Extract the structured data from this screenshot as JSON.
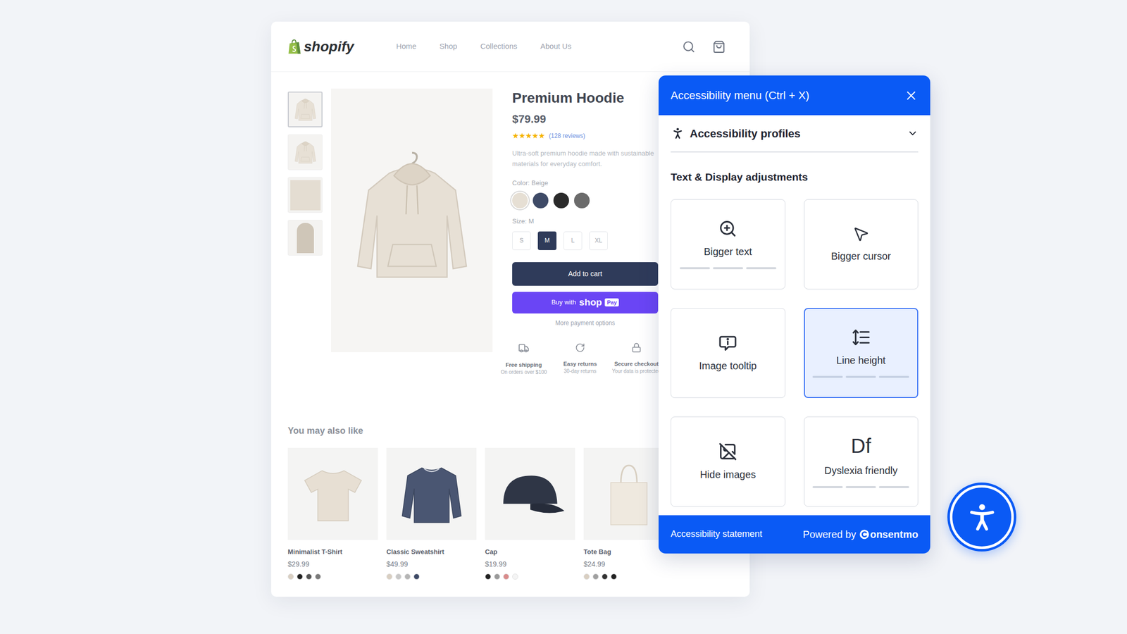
{
  "store": {
    "logo": "shopify",
    "nav": [
      "Home",
      "Shop",
      "Collections",
      "About Us"
    ],
    "thumbnails": [
      {
        "selected": true
      },
      {
        "selected": false
      },
      {
        "selected": false
      },
      {
        "selected": false
      }
    ],
    "product": {
      "title": "Premium Hoodie",
      "price": "$79.99",
      "stars": 5,
      "reviews": "(128 reviews)",
      "description": "Ultra-soft premium hoodie made with sustainable materials for everyday comfort.",
      "color_label": "Color: Beige",
      "colors": [
        {
          "color": "#e6dfd4",
          "selected": true
        },
        {
          "color": "#3e4a66",
          "selected": false
        },
        {
          "color": "#2a2a2a",
          "selected": false
        },
        {
          "color": "#6b6b6b",
          "selected": false
        }
      ],
      "size_label": "Size: M",
      "sizes": [
        {
          "label": "S",
          "selected": false
        },
        {
          "label": "M",
          "selected": true
        },
        {
          "label": "L",
          "selected": false
        },
        {
          "label": "XL",
          "selected": false
        }
      ],
      "add_to_cart": "Add to cart",
      "buy_prefix": "Buy with",
      "buy_brand": "shop",
      "buy_badge": "Pay",
      "more_options": "More payment options",
      "features": [
        {
          "title": "Free shipping",
          "subtitle": "On orders over $100"
        },
        {
          "title": "Easy returns",
          "subtitle": "30-day returns"
        },
        {
          "title": "Secure checkout",
          "subtitle": "Your data is protected"
        }
      ]
    },
    "related": {
      "title": "You may also like",
      "items": [
        {
          "name": "Minimalist T-Shirt",
          "price": "$29.99",
          "colors": [
            {
              "color": "#d9cfc2"
            },
            {
              "color": "#222222"
            },
            {
              "color": "#555555"
            },
            {
              "color": "#7a7a7a"
            }
          ]
        },
        {
          "name": "Classic Sweatshirt",
          "price": "$49.99",
          "colors": [
            {
              "color": "#d9cfc2"
            },
            {
              "color": "#c8c8c8"
            },
            {
              "color": "#b5b5b5"
            },
            {
              "color": "#3e4a66"
            }
          ]
        },
        {
          "name": "Cap",
          "price": "$19.99",
          "colors": [
            {
              "color": "#222222"
            },
            {
              "color": "#9a9a9a"
            },
            {
              "color": "#d98b8b"
            },
            {
              "color": "#f4f4f4"
            }
          ]
        },
        {
          "name": "Tote Bag",
          "price": "$24.99",
          "colors": [
            {
              "color": "#d9cfc2"
            },
            {
              "color": "#a0a0a0"
            },
            {
              "color": "#333333"
            },
            {
              "color": "#222222"
            }
          ]
        }
      ]
    }
  },
  "panel": {
    "title": "Accessibility menu (Ctrl + X)",
    "profiles": {
      "label": "Accessibility profiles",
      "expanded": false
    },
    "section": "Text & Display adjustments",
    "tiles": [
      {
        "label": "Bigger text",
        "kind": "stepped",
        "steps": 3,
        "level": 0,
        "selected": false
      },
      {
        "label": "Bigger cursor",
        "kind": "toggle",
        "selected": false
      },
      {
        "label": "Image tooltip",
        "kind": "toggle",
        "selected": false
      },
      {
        "label": "Line height",
        "kind": "stepped",
        "steps": 3,
        "level": 0,
        "selected": true
      },
      {
        "label": "Hide images",
        "kind": "toggle",
        "selected": false
      },
      {
        "label": "Dyslexia friendly",
        "kind": "glyph",
        "glyph": "Df",
        "steps": 3,
        "level": 0,
        "selected": false
      }
    ],
    "footer": {
      "statement": "Accessibility statement",
      "powered": "Powered by",
      "brand": "onsentmo"
    }
  }
}
